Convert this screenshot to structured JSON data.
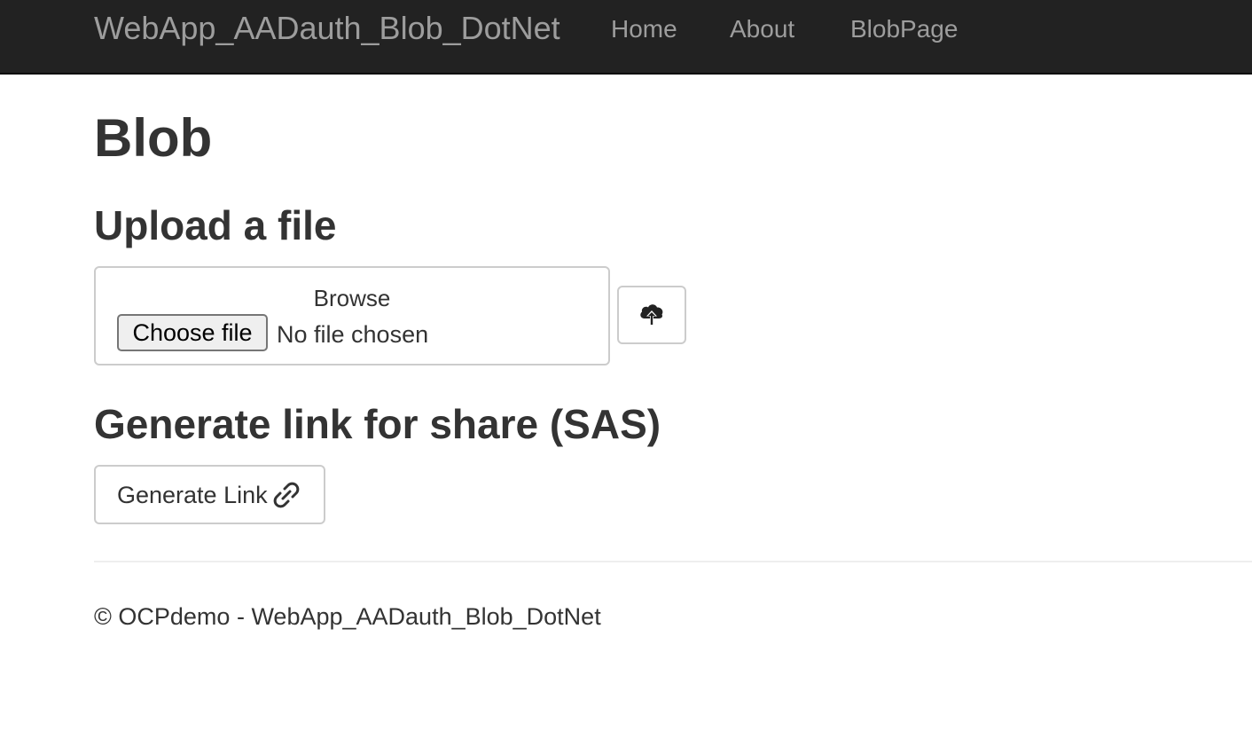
{
  "navbar": {
    "brand": "WebApp_AADauth_Blob_DotNet",
    "links": [
      "Home",
      "About",
      "BlobPage"
    ],
    "background": "#222222",
    "link_color": "#9d9d9d"
  },
  "page": {
    "title": "Blob"
  },
  "upload": {
    "heading": "Upload a file",
    "browse_label": "Browse",
    "choose_button": "Choose file",
    "file_status": "No file chosen",
    "upload_icon": "cloud-upload-icon"
  },
  "sas": {
    "heading": "Generate link for share (SAS)",
    "button_label": "Generate Link",
    "button_icon": "link-icon"
  },
  "footer": {
    "text": "© OCPdemo - WebApp_AADauth_Blob_DotNet"
  }
}
